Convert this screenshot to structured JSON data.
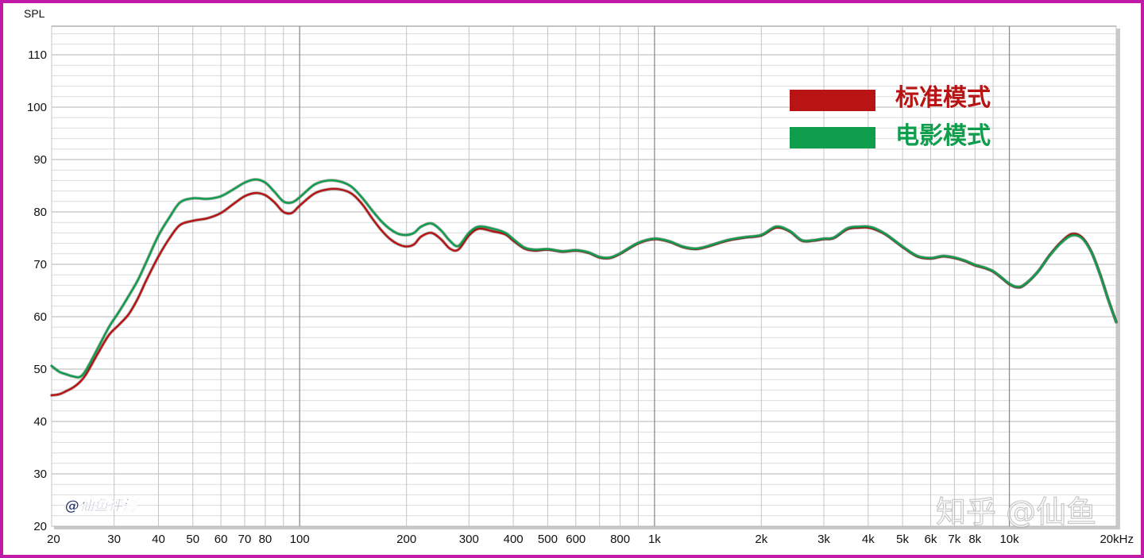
{
  "chart_data": {
    "type": "line",
    "ylabel": "SPL",
    "x_scale": "log",
    "xlim": [
      20,
      20000
    ],
    "ylim": [
      20,
      115
    ],
    "y_ticks": [
      20,
      30,
      40,
      50,
      60,
      70,
      80,
      90,
      100,
      110
    ],
    "x_ticks": [
      {
        "value": 20,
        "label": "20"
      },
      {
        "value": 30,
        "label": "30"
      },
      {
        "value": 40,
        "label": "40"
      },
      {
        "value": 50,
        "label": "50"
      },
      {
        "value": 60,
        "label": "60"
      },
      {
        "value": 70,
        "label": "70"
      },
      {
        "value": 80,
        "label": "80"
      },
      {
        "value": 100,
        "label": "100"
      },
      {
        "value": 200,
        "label": "200"
      },
      {
        "value": 300,
        "label": "300"
      },
      {
        "value": 400,
        "label": "400"
      },
      {
        "value": 500,
        "label": "500"
      },
      {
        "value": 600,
        "label": "600"
      },
      {
        "value": 800,
        "label": "800"
      },
      {
        "value": 1000,
        "label": "1k"
      },
      {
        "value": 2000,
        "label": "2k"
      },
      {
        "value": 3000,
        "label": "3k"
      },
      {
        "value": 4000,
        "label": "4k"
      },
      {
        "value": 5000,
        "label": "5k"
      },
      {
        "value": 6000,
        "label": "6k"
      },
      {
        "value": 7000,
        "label": "7k"
      },
      {
        "value": 8000,
        "label": "8k"
      },
      {
        "value": 10000,
        "label": "10k"
      },
      {
        "value": 20000,
        "label": "20kHz"
      }
    ],
    "grid": true,
    "legend_position": "top-right",
    "series": [
      {
        "name": "标准模式",
        "color": "#b81414",
        "points": [
          [
            20,
            45.0
          ],
          [
            21,
            45.2
          ],
          [
            22,
            45.8
          ],
          [
            23,
            46.5
          ],
          [
            24,
            47.5
          ],
          [
            25,
            49.0
          ],
          [
            27,
            53.0
          ],
          [
            29,
            56.5
          ],
          [
            31,
            58.5
          ],
          [
            33,
            60.5
          ],
          [
            35,
            63.5
          ],
          [
            37,
            67.0
          ],
          [
            40,
            71.5
          ],
          [
            43,
            75.0
          ],
          [
            46,
            77.5
          ],
          [
            50,
            78.3
          ],
          [
            55,
            78.8
          ],
          [
            60,
            79.8
          ],
          [
            65,
            81.5
          ],
          [
            70,
            83.0
          ],
          [
            75,
            83.6
          ],
          [
            80,
            83.2
          ],
          [
            85,
            81.8
          ],
          [
            90,
            80.0
          ],
          [
            95,
            79.8
          ],
          [
            100,
            81.2
          ],
          [
            110,
            83.5
          ],
          [
            120,
            84.3
          ],
          [
            130,
            84.3
          ],
          [
            140,
            83.5
          ],
          [
            150,
            81.5
          ],
          [
            160,
            78.8
          ],
          [
            170,
            76.5
          ],
          [
            180,
            74.8
          ],
          [
            190,
            73.8
          ],
          [
            200,
            73.4
          ],
          [
            210,
            73.8
          ],
          [
            220,
            75.3
          ],
          [
            235,
            76.0
          ],
          [
            250,
            74.8
          ],
          [
            265,
            73.0
          ],
          [
            280,
            72.8
          ],
          [
            300,
            75.5
          ],
          [
            320,
            76.8
          ],
          [
            350,
            76.3
          ],
          [
            380,
            75.7
          ],
          [
            400,
            74.5
          ],
          [
            430,
            73.0
          ],
          [
            460,
            72.6
          ],
          [
            500,
            72.8
          ],
          [
            550,
            72.4
          ],
          [
            600,
            72.6
          ],
          [
            650,
            72.2
          ],
          [
            700,
            71.3
          ],
          [
            750,
            71.2
          ],
          [
            800,
            72.0
          ],
          [
            900,
            74.0
          ],
          [
            1000,
            74.8
          ],
          [
            1100,
            74.3
          ],
          [
            1200,
            73.3
          ],
          [
            1300,
            72.9
          ],
          [
            1400,
            73.3
          ],
          [
            1600,
            74.5
          ],
          [
            1800,
            75.1
          ],
          [
            2000,
            75.5
          ],
          [
            2200,
            77.0
          ],
          [
            2400,
            76.3
          ],
          [
            2600,
            74.5
          ],
          [
            2800,
            74.5
          ],
          [
            3000,
            74.8
          ],
          [
            3200,
            75.0
          ],
          [
            3500,
            76.7
          ],
          [
            3800,
            77.0
          ],
          [
            4000,
            77.0
          ],
          [
            4200,
            76.6
          ],
          [
            4500,
            75.6
          ],
          [
            5000,
            73.3
          ],
          [
            5500,
            71.5
          ],
          [
            6000,
            71.1
          ],
          [
            6500,
            71.5
          ],
          [
            7000,
            71.2
          ],
          [
            7500,
            70.6
          ],
          [
            8000,
            69.8
          ],
          [
            8500,
            69.3
          ],
          [
            9000,
            68.6
          ],
          [
            9500,
            67.4
          ],
          [
            10000,
            66.2
          ],
          [
            10500,
            65.6
          ],
          [
            11000,
            66.0
          ],
          [
            12000,
            68.5
          ],
          [
            13000,
            71.8
          ],
          [
            14000,
            74.3
          ],
          [
            15000,
            75.8
          ],
          [
            16000,
            75.2
          ],
          [
            17000,
            72.5
          ],
          [
            18000,
            68.2
          ],
          [
            19000,
            63.3
          ],
          [
            20000,
            59.0
          ]
        ]
      },
      {
        "name": "电影模式",
        "color": "#0f9e4c",
        "points": [
          [
            20,
            50.6
          ],
          [
            21,
            49.5
          ],
          [
            22,
            49.0
          ],
          [
            23,
            48.6
          ],
          [
            24,
            48.5
          ],
          [
            25,
            49.8
          ],
          [
            27,
            54.0
          ],
          [
            29,
            58.0
          ],
          [
            31,
            61.0
          ],
          [
            33,
            64.0
          ],
          [
            35,
            67.0
          ],
          [
            37,
            70.5
          ],
          [
            40,
            75.5
          ],
          [
            43,
            79.0
          ],
          [
            46,
            81.8
          ],
          [
            50,
            82.6
          ],
          [
            55,
            82.5
          ],
          [
            60,
            83.0
          ],
          [
            65,
            84.3
          ],
          [
            70,
            85.6
          ],
          [
            75,
            86.2
          ],
          [
            80,
            85.6
          ],
          [
            85,
            83.8
          ],
          [
            90,
            82.0
          ],
          [
            95,
            81.8
          ],
          [
            100,
            82.8
          ],
          [
            110,
            85.2
          ],
          [
            120,
            86.0
          ],
          [
            130,
            85.8
          ],
          [
            140,
            84.8
          ],
          [
            150,
            82.7
          ],
          [
            160,
            80.3
          ],
          [
            170,
            78.2
          ],
          [
            180,
            76.7
          ],
          [
            190,
            75.8
          ],
          [
            200,
            75.6
          ],
          [
            210,
            76.0
          ],
          [
            220,
            77.2
          ],
          [
            235,
            77.8
          ],
          [
            250,
            76.5
          ],
          [
            265,
            74.5
          ],
          [
            280,
            73.5
          ],
          [
            300,
            76.0
          ],
          [
            320,
            77.2
          ],
          [
            350,
            76.8
          ],
          [
            380,
            76.0
          ],
          [
            400,
            74.8
          ],
          [
            430,
            73.2
          ],
          [
            460,
            72.8
          ],
          [
            500,
            72.9
          ],
          [
            550,
            72.5
          ],
          [
            600,
            72.7
          ],
          [
            650,
            72.3
          ],
          [
            700,
            71.4
          ],
          [
            750,
            71.3
          ],
          [
            800,
            72.1
          ],
          [
            900,
            74.1
          ],
          [
            1000,
            74.9
          ],
          [
            1100,
            74.4
          ],
          [
            1200,
            73.4
          ],
          [
            1300,
            73.0
          ],
          [
            1400,
            73.4
          ],
          [
            1600,
            74.6
          ],
          [
            1800,
            75.2
          ],
          [
            2000,
            75.6
          ],
          [
            2200,
            77.2
          ],
          [
            2400,
            76.4
          ],
          [
            2600,
            74.6
          ],
          [
            2800,
            74.6
          ],
          [
            3000,
            74.9
          ],
          [
            3200,
            75.1
          ],
          [
            3500,
            76.9
          ],
          [
            3800,
            77.2
          ],
          [
            4000,
            77.2
          ],
          [
            4200,
            76.8
          ],
          [
            4500,
            75.7
          ],
          [
            5000,
            73.4
          ],
          [
            5500,
            71.6
          ],
          [
            6000,
            71.2
          ],
          [
            6500,
            71.6
          ],
          [
            7000,
            71.3
          ],
          [
            7500,
            70.7
          ],
          [
            8000,
            69.9
          ],
          [
            8500,
            69.4
          ],
          [
            9000,
            68.7
          ],
          [
            9500,
            67.5
          ],
          [
            10000,
            66.3
          ],
          [
            10500,
            65.7
          ],
          [
            11000,
            66.1
          ],
          [
            12000,
            68.5
          ],
          [
            13000,
            71.7
          ],
          [
            14000,
            74.1
          ],
          [
            15000,
            75.5
          ],
          [
            16000,
            75.0
          ],
          [
            17000,
            72.4
          ],
          [
            18000,
            68.1
          ],
          [
            19000,
            63.2
          ],
          [
            20000,
            59.0
          ]
        ]
      }
    ]
  },
  "legend": {
    "items": [
      {
        "label": "标准模式",
        "color": "#b81414"
      },
      {
        "label": "电影模式",
        "color": "#0f9e4c"
      }
    ]
  },
  "watermark": {
    "corner_text": "@仙鱼评测",
    "bottom_right_text": "知乎 @仙鱼"
  },
  "frame": {
    "border_color": "#c21aa8"
  }
}
